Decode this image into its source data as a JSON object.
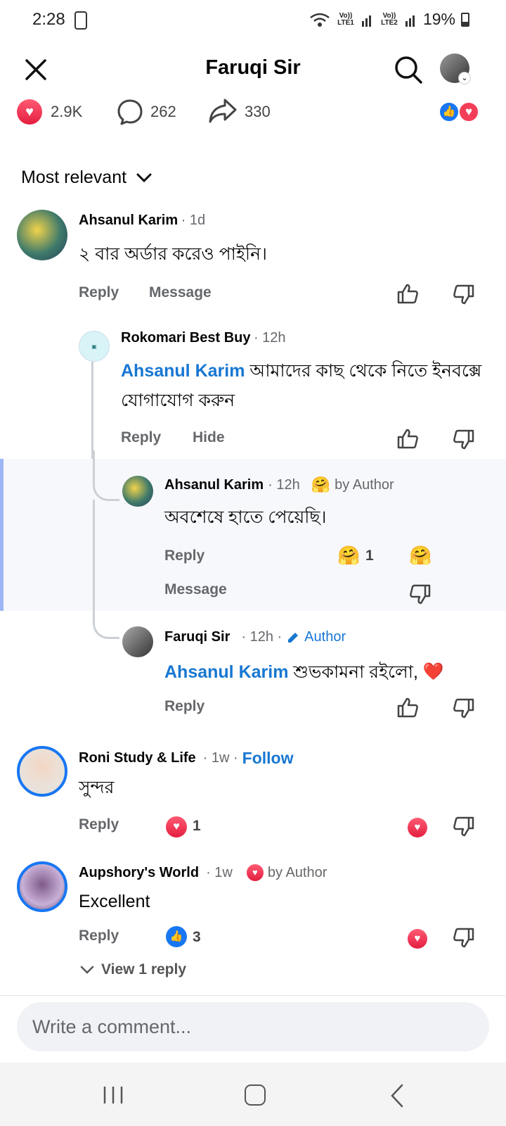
{
  "status_bar": {
    "time": "2:28",
    "lte1": "Vo)) LTE1",
    "lte2": "Vo)) LTE2",
    "battery": "19%"
  },
  "header": {
    "title": "Faruqi Sir"
  },
  "reactions": {
    "likes": "2.9K",
    "comments": "262",
    "shares": "330"
  },
  "sort": {
    "label": "Most relevant"
  },
  "comments": [
    {
      "name": "Ahsanul Karim",
      "time": "· 1d",
      "text": "২ বার অর্ডার করেও পাইনি।",
      "reply": "Reply",
      "message": "Message"
    },
    {
      "name": "Rokomari Best Buy",
      "time": "· 12h",
      "mention": "Ahsanul Karim",
      "text": " আমাদের কাছ থেকে নিতে ইনবক্সে যোগাযোগ করুন",
      "reply": "Reply",
      "hide": "Hide"
    },
    {
      "name": "Ahsanul Karim",
      "time": "· 12h",
      "badge": "by Author",
      "text": "অবশেষে হাতে পেয়েছি।",
      "reply": "Reply",
      "reaction_count": "1",
      "message": "Message"
    },
    {
      "name": "Faruqi Sir",
      "time": "· 12h ·",
      "badge": "Author",
      "mention": "Ahsanul Karim",
      "text": " শুভকামনা রইলো, ",
      "reply": "Reply"
    },
    {
      "name": "Roni Study & Life",
      "time": "· 1w ·",
      "follow": "Follow",
      "text": "সুন্দর",
      "reply": "Reply",
      "reaction_count": "1"
    },
    {
      "name": "Aupshory's World",
      "time": "· 1w",
      "badge": "by Author",
      "text": "Excellent",
      "reply": "Reply",
      "reaction_count": "3",
      "view_replies": "View 1 reply"
    }
  ],
  "composer": {
    "placeholder": "Write a comment..."
  },
  "icons": {
    "close": "close-icon",
    "search": "search-icon",
    "heart": "heart-icon",
    "comment": "comment-icon",
    "share": "share-icon",
    "like": "like-icon",
    "dislike": "dislike-icon",
    "care": "care-emoji-icon"
  },
  "colors": {
    "accent": "#1877d2",
    "heart": "#e41e3f",
    "like": "#1877f2"
  }
}
